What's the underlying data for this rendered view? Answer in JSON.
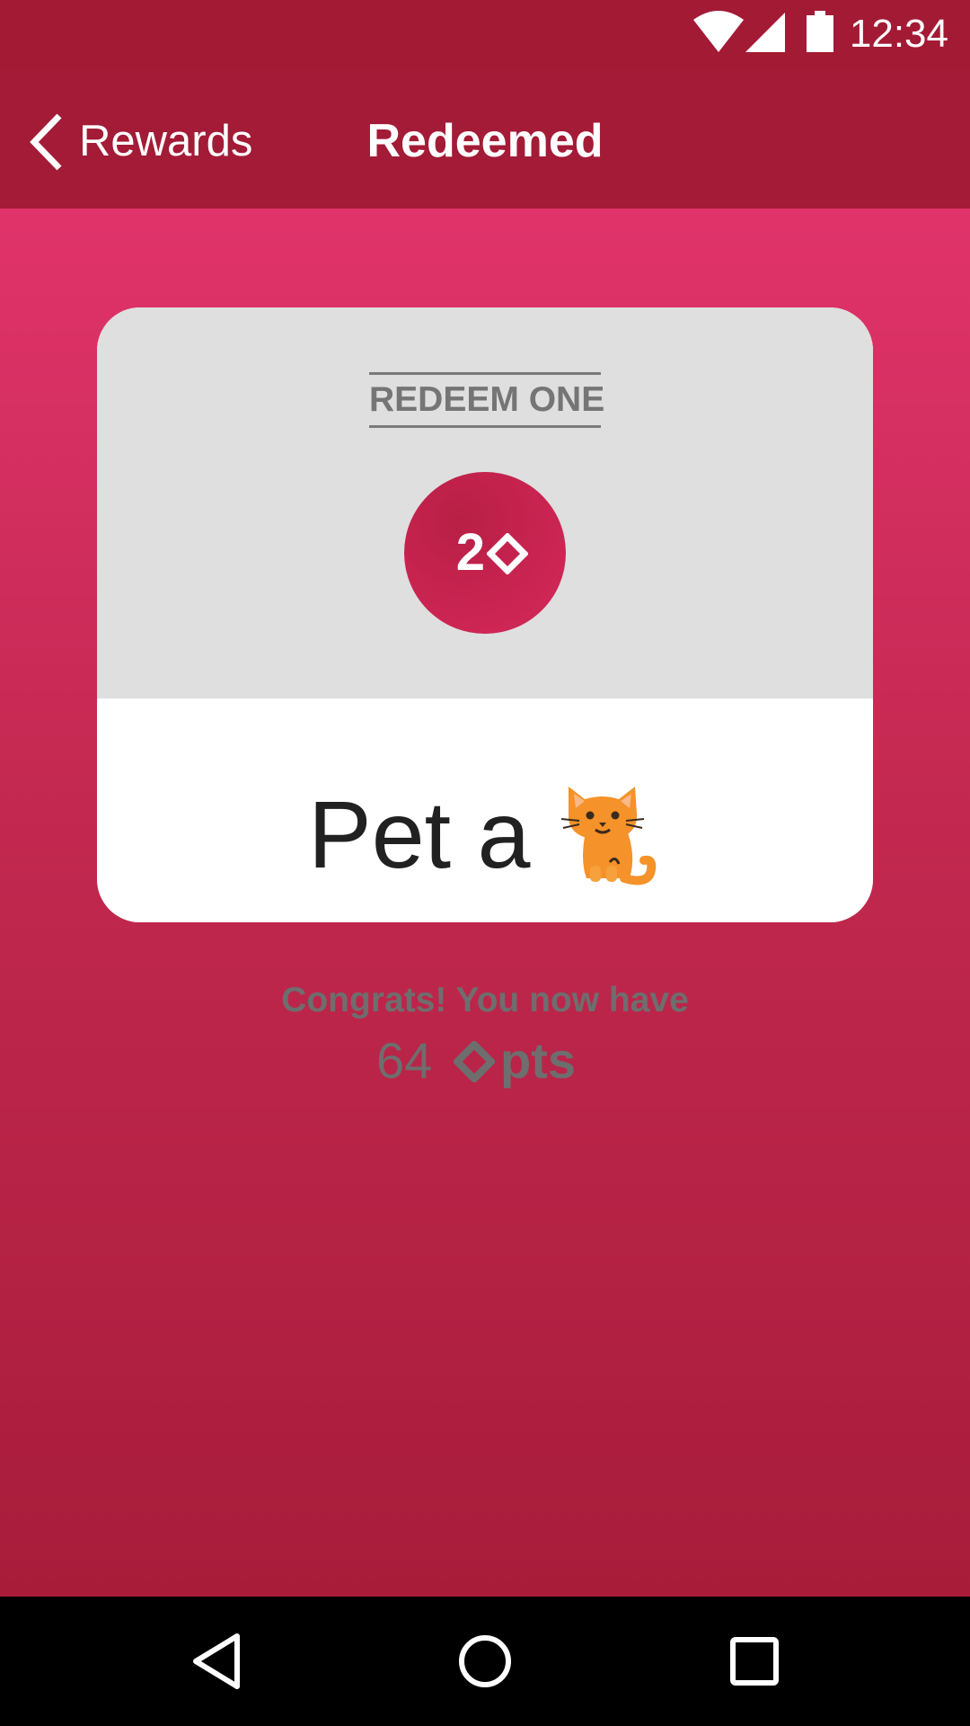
{
  "status_bar": {
    "time": "12:34",
    "icons": [
      "wifi-icon",
      "cell-signal-icon",
      "battery-icon"
    ]
  },
  "toolbar": {
    "back_label": "Rewards",
    "back_icon": "chevron-left-icon",
    "title": "Redeemed"
  },
  "card": {
    "action_label": "REDEEM ONE",
    "cost": "2",
    "cost_icon": "diamond-icon",
    "reward_text": "Pet a",
    "reward_icon": "cat-icon",
    "message": "Congrats! You now have",
    "points_value": "64",
    "points_icon": "diamond-icon",
    "points_unit": "pts"
  },
  "nav_bar": {
    "buttons": [
      "back-triangle-icon",
      "home-circle-icon",
      "recents-square-icon"
    ]
  },
  "colors": {
    "toolbar": "#a31b36",
    "gradient_top": "#e0336b",
    "gradient_bottom": "#a81c3a",
    "badge": "#c6234f",
    "card_top": "#dfdfdf",
    "muted_text": "#6e6e6e"
  }
}
